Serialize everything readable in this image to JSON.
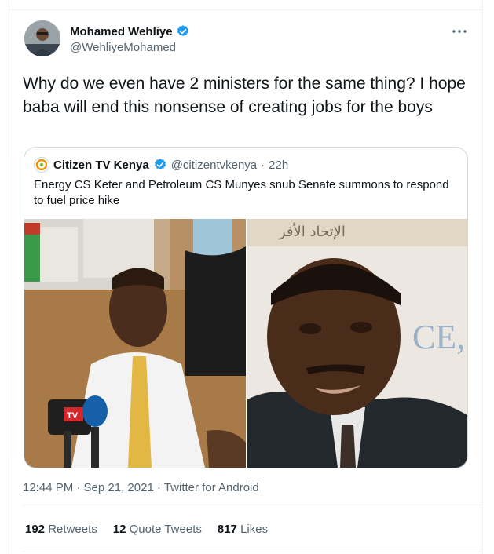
{
  "tweet": {
    "author_name": "Mohamed Wehliye",
    "author_handle": "@WehliyeMohamed",
    "more_icon": "more-horizontal-icon",
    "text": "Why do we even have 2 ministers for the same thing? I hope baba will end this nonsense of creating jobs for the boys",
    "timestamp": "12:44 PM · Sep 21, 2021 · Twitter for Android"
  },
  "quote": {
    "author_name": "Citizen TV Kenya",
    "author_handle": "@citizentvkenya",
    "separator": "·",
    "time": "22h",
    "text": "Energy CS Keter and Petroleum CS Munyes snub Senate summons to respond to fuel price hike",
    "photo_banner_text": "الإتحاد الأفر",
    "photo_bg_text": "CE,",
    "mic_label": "TV"
  },
  "stats": [
    {
      "count": "192",
      "label": "Retweets"
    },
    {
      "count": "12",
      "label": "Quote Tweets"
    },
    {
      "count": "817",
      "label": "Likes"
    }
  ],
  "colors": {
    "accent": "#1d9bf0",
    "text": "#0f1419",
    "secondary": "#536471",
    "border": "#cfd9de"
  }
}
